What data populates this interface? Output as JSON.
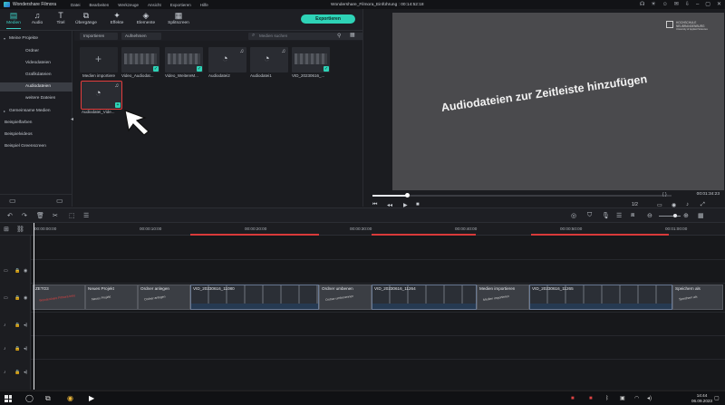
{
  "window": {
    "app_title": "Wondershare Filmora",
    "project_title": "Wondershare_Filmora_Einführung : 00:14:52:18",
    "menu": [
      "Datei",
      "Bearbeiten",
      "Werkzeuge",
      "Ansicht",
      "Exportieren",
      "Hilfe"
    ]
  },
  "toolbar": {
    "tabs": [
      "Medien",
      "Audio",
      "Titel",
      "Übergänge",
      "Effekte",
      "Elemente",
      "Splitscreen"
    ],
    "export_label": "Exportieren"
  },
  "sidebar": {
    "items": [
      {
        "label": "Meine Projekte",
        "caret": "▾"
      },
      {
        "label": "Ordner",
        "caret": ""
      },
      {
        "label": "Videodateien",
        "caret": ""
      },
      {
        "label": "Grafikdateien",
        "caret": ""
      },
      {
        "label": "Audiodateien",
        "caret": ""
      },
      {
        "label": "weitere Dateien",
        "caret": ""
      },
      {
        "label": "Gemeinsame Medien",
        "caret": "▸"
      },
      {
        "label": "Beispielfarben",
        "caret": ""
      },
      {
        "label": "Beispielvideos",
        "caret": ""
      },
      {
        "label": "Beispiel Greenscreen",
        "caret": ""
      }
    ]
  },
  "media": {
    "import_label": "Importieren",
    "record_label": "Aufnehmen",
    "search_placeholder": "Medien suchen",
    "tiles": [
      {
        "name": "Medien importiere"
      },
      {
        "name": "Video_Audiodat..."
      },
      {
        "name": "Video_WeitereM..."
      },
      {
        "name": "Audiodatei2"
      },
      {
        "name": "Audiodatei1"
      },
      {
        "name": "VID_20230616_..."
      },
      {
        "name": "Audiodatei_Vide..."
      }
    ]
  },
  "preview": {
    "caption": "Audiodateien zur Zeitleiste hinzufügen",
    "brand_line1": "HOCHSCHULE",
    "brand_line2": "NEUBRANDENBURG",
    "brand_line3": "University of Applied Sciences",
    "timecode": "00:01:34:23",
    "quality": "1/2",
    "braces": "{  }",
    "progress": 0.12
  },
  "timeline": {
    "ruler": [
      "00:00:00:00",
      "00:00:10:00",
      "00:00:20:00",
      "00:00:30:00",
      "00:00:40:00",
      "00:00:50:00",
      "00:01:00:00",
      "00:01:10:00"
    ],
    "clips": [
      {
        "label": "ZETO3",
        "kind": "title red",
        "sub": "Wondershare Filmora Intro"
      },
      {
        "label": "Neues Projekt",
        "kind": "title",
        "sub": "Neues Projekt"
      },
      {
        "label": "Ordner anlegen",
        "kind": "title",
        "sub": "Ordner anlegen"
      },
      {
        "label": "VID_20230616_11080",
        "kind": "video",
        "sub": ""
      },
      {
        "label": "Ordner umbenen",
        "kind": "title",
        "sub": "Ordner umbenennen"
      },
      {
        "label": "VID_20230616_11264",
        "kind": "video",
        "sub": ""
      },
      {
        "label": "Medien importieren",
        "kind": "title",
        "sub": "Medien importieren"
      },
      {
        "label": "VID_20230616_11265",
        "kind": "video",
        "sub": ""
      },
      {
        "label": "Speichern als",
        "kind": "title",
        "sub": "Speichern als"
      }
    ]
  },
  "taskbar": {
    "time": "14:44",
    "date": "06.09.2023"
  },
  "colors": {
    "accent": "#2ed3b7",
    "highlight_box": "#e33d3d",
    "ruler_marker": "#d93a3a"
  }
}
